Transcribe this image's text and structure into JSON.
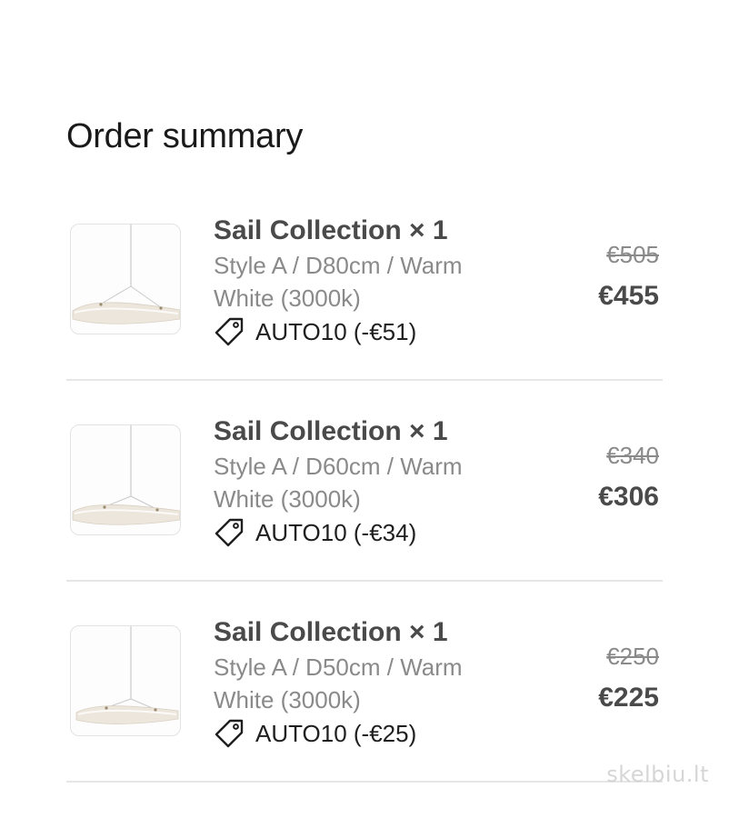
{
  "header": {
    "title": "Order summary"
  },
  "items": [
    {
      "name": "Sail Collection × 1",
      "variant": "Style A / D80cm / Warm White (3000k)",
      "discount": "AUTO10 (-€51)",
      "original_price": "€505",
      "price": "€455",
      "icon": "tag-icon"
    },
    {
      "name": "Sail Collection × 1",
      "variant": "Style A / D60cm / Warm White (3000k)",
      "discount": "AUTO10 (-€34)",
      "original_price": "€340",
      "price": "€306",
      "icon": "tag-icon"
    },
    {
      "name": "Sail Collection × 1",
      "variant": "Style A / D50cm / Warm White (3000k)",
      "discount": "AUTO10 (-€25)",
      "original_price": "€250",
      "price": "€225",
      "icon": "tag-icon"
    }
  ],
  "watermark": {
    "text": "skelbiu.lt"
  },
  "colors": {
    "text_primary": "#4a4a4a",
    "text_secondary": "#8a8a8a",
    "divider": "#e6e6e6"
  }
}
